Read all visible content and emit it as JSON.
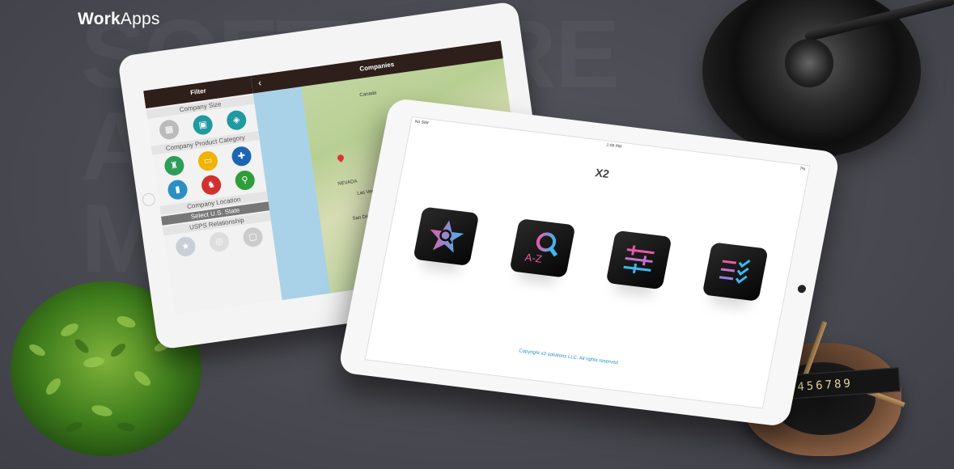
{
  "brand": {
    "prefix": "Work",
    "suffix": "Apps"
  },
  "back_tablet": {
    "filter_title": "Filter",
    "companies_title": "Companies",
    "sections": [
      "Company Size",
      "Company Product Category",
      "Company Location",
      "USPS Relationship"
    ],
    "select_state": "Select U.S. State",
    "map_labels": [
      "Canada",
      "Las Vegas",
      "San Diego",
      "NEVADA"
    ]
  },
  "front_tablet": {
    "carrier": "No SIM",
    "time": "1:09 PM",
    "battery": "7%",
    "logo_text": "X2",
    "copyright": "Copyright x2-solutions LLC. All rights reserved.",
    "tile_az_label": "A-Z"
  },
  "ruler_text": "123456789",
  "colors": {
    "accent": "#2b8fc6",
    "header": "#2e1f1a",
    "tile_pink": "#e85aa8",
    "tile_blue": "#3db8f0"
  }
}
